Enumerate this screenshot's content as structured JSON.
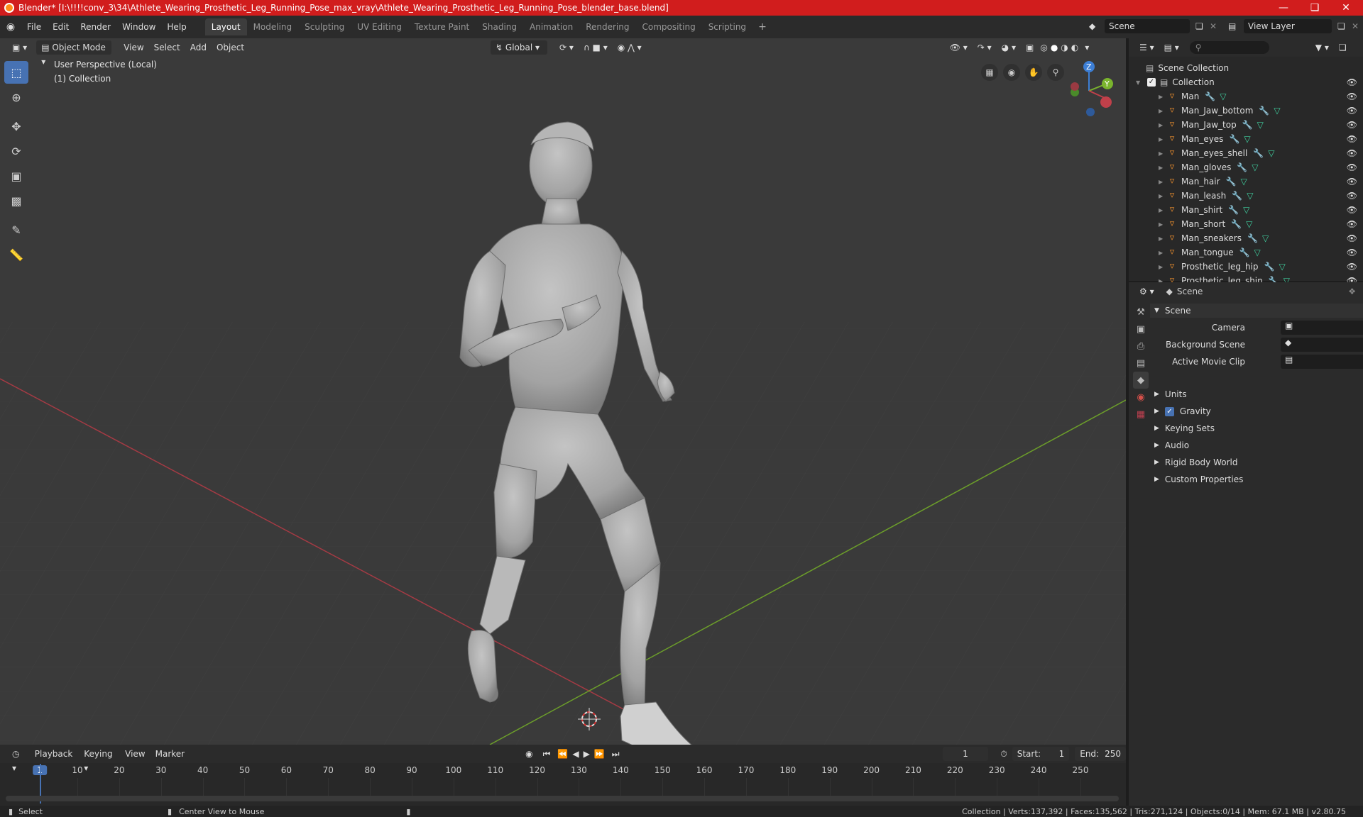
{
  "window": {
    "title": "Blender* [I:\\!!!!conv_3\\34\\Athlete_Wearing_Prosthetic_Leg_Running_Pose_max_vray\\Athlete_Wearing_Prosthetic_Leg_Running_Pose_blender_base.blend]"
  },
  "menu": [
    "File",
    "Edit",
    "Render",
    "Window",
    "Help"
  ],
  "workspaces": [
    "Layout",
    "Modeling",
    "Sculpting",
    "UV Editing",
    "Texture Paint",
    "Shading",
    "Animation",
    "Rendering",
    "Compositing",
    "Scripting"
  ],
  "active_workspace": "Layout",
  "scene_selector": "Scene",
  "view_layer_selector": "View Layer",
  "viewport": {
    "mode": "Object Mode",
    "menus": [
      "View",
      "Select",
      "Add",
      "Object"
    ],
    "transform_orientation": "Global",
    "overlay_line1": "User Perspective (Local)",
    "overlay_line2": "(1) Collection",
    "gizmo_axes": {
      "z": "Z",
      "y": "Y"
    }
  },
  "outliner": {
    "root": "Scene Collection",
    "collection": "Collection",
    "objects": [
      "Man",
      "Man_Jaw_bottom",
      "Man_Jaw_top",
      "Man_eyes",
      "Man_eyes_shell",
      "Man_gloves",
      "Man_hair",
      "Man_leash",
      "Man_shirt",
      "Man_short",
      "Man_sneakers",
      "Man_tongue",
      "Prosthetic_leg_hip",
      "Prosthetic_leg_shin"
    ]
  },
  "properties": {
    "context": "Scene",
    "panel": "Scene",
    "fields": [
      {
        "label": "Camera"
      },
      {
        "label": "Background Scene"
      },
      {
        "label": "Active Movie Clip"
      }
    ],
    "sections": [
      "Units",
      "Gravity",
      "Keying Sets",
      "Audio",
      "Rigid Body World",
      "Custom Properties"
    ],
    "gravity_checked": true
  },
  "timeline": {
    "menus": [
      "Playback",
      "Keying",
      "View",
      "Marker"
    ],
    "current_frame": "1",
    "start_label": "Start:",
    "start": "1",
    "end_label": "End:",
    "end": "250",
    "ticks": [
      "1",
      "10",
      "20",
      "30",
      "40",
      "50",
      "60",
      "70",
      "80",
      "90",
      "100",
      "110",
      "120",
      "130",
      "140",
      "150",
      "160",
      "170",
      "180",
      "190",
      "200",
      "210",
      "220",
      "230",
      "240",
      "250"
    ]
  },
  "status": {
    "left_action": "Select",
    "middle_action": "Center View to Mouse",
    "stats": "Collection | Verts:137,392 | Faces:135,562 | Tris:271,124 | Objects:0/14 | Mem: 67.1 MB | v2.80.75"
  },
  "colors": {
    "title_bar": "#d11d1d",
    "accent": "#4772b3",
    "x_axis": "#c0404a",
    "y_axis": "#7ab42d",
    "z_axis": "#3d7fd6"
  }
}
